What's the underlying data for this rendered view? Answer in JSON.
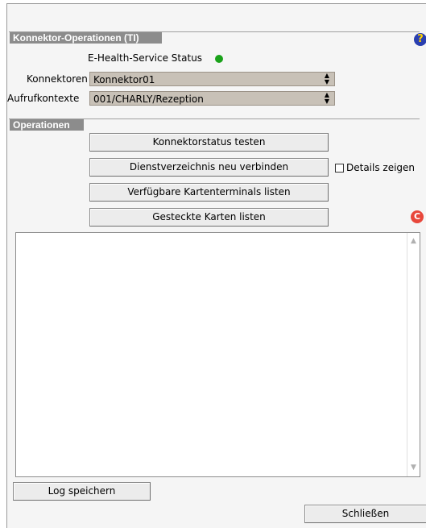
{
  "connector_section": {
    "title": "Konnektor-Operationen (TI)",
    "status_label": "E-Health-Service Status",
    "status_color": "#1aa21a",
    "konnektoren_label": "Konnektoren",
    "konnektoren_value": "Konnektor01",
    "aufrufkontexte_label": "Aufrufkontexte",
    "aufrufkontexte_value": "001/CHARLY/Rezeption"
  },
  "operations_section": {
    "title": "Operationen",
    "buttons": {
      "test_status": "Konnektorstatus testen",
      "reconnect_directory": "Dienstverzeichnis neu verbinden",
      "list_terminals": "Verfügbare Kartenterminals listen",
      "list_cards": "Gesteckte Karten listen"
    },
    "details_checkbox_label": "Details zeigen",
    "details_checked": false
  },
  "log": {
    "content": ""
  },
  "footer": {
    "save_log_label": "Log speichern",
    "close_label": "Schließen"
  },
  "icons": {
    "help": "help-icon",
    "reload": "reload-icon"
  },
  "colors": {
    "section_header_bg": "#8c8c8c",
    "select_bg": "#c8c1b7",
    "help_icon": "#2a3fb0",
    "reload_icon": "#e8473b"
  }
}
